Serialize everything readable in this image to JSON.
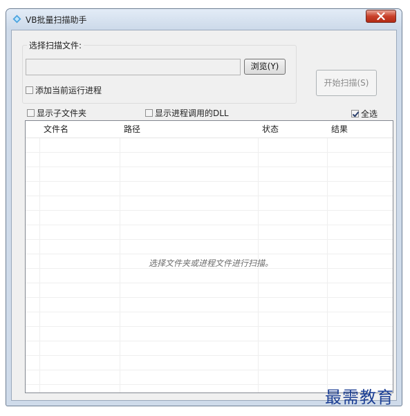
{
  "window": {
    "title": "VB批量扫描助手"
  },
  "scan_file_group": {
    "label": "选择扫描文件:",
    "path_value": "",
    "browse_label": "浏览(Y)",
    "add_process_label": "添加当前运行进程",
    "add_process_checked": false
  },
  "start_scan_label": "开始扫描(S)",
  "options": {
    "show_subfolders": {
      "label": "显示子文件夹",
      "checked": false
    },
    "show_dll": {
      "label": "显示进程调用的DLL",
      "checked": false
    },
    "select_all": {
      "label": "全选",
      "checked": true
    }
  },
  "table": {
    "columns": [
      "文件名",
      "路径",
      "状态",
      "结果"
    ],
    "rows": [],
    "empty_message": "选择文件夹或进程文件进行扫描。"
  },
  "watermark": "最需教育",
  "colors": {
    "watermark": "#1c3f94",
    "close_button": "#c9412b"
  }
}
